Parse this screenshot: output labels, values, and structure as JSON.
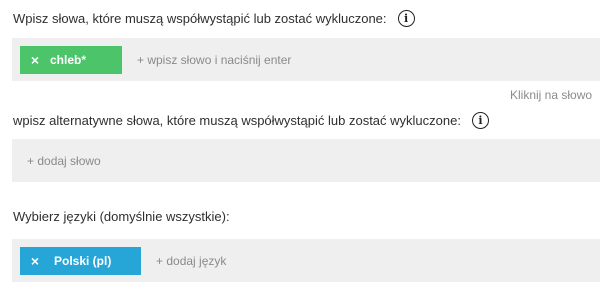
{
  "section1": {
    "label": "Wpisz słowa, które muszą współwystąpić lub zostać wykluczone:",
    "info_icon": "info-icon",
    "chips": [
      {
        "label": "chleb*",
        "remove": "×"
      }
    ],
    "input_placeholder": "+ wpisz słowo i naciśnij enter",
    "chip_color": "#4cc56a"
  },
  "hint": "Kliknij na słowo",
  "section2": {
    "label": "wpisz alternatywne słowa, które muszą współwystąpić lub zostać wykluczone:",
    "info_icon": "info-icon",
    "input_placeholder": "+ dodaj słowo"
  },
  "section3": {
    "label": "Wybierz języki (domyślnie wszystkie):",
    "chips": [
      {
        "label": "Polski (pl)",
        "remove": "×"
      }
    ],
    "input_placeholder": "+ dodaj język",
    "chip_color": "#26a5d7"
  },
  "info_glyph": "i"
}
